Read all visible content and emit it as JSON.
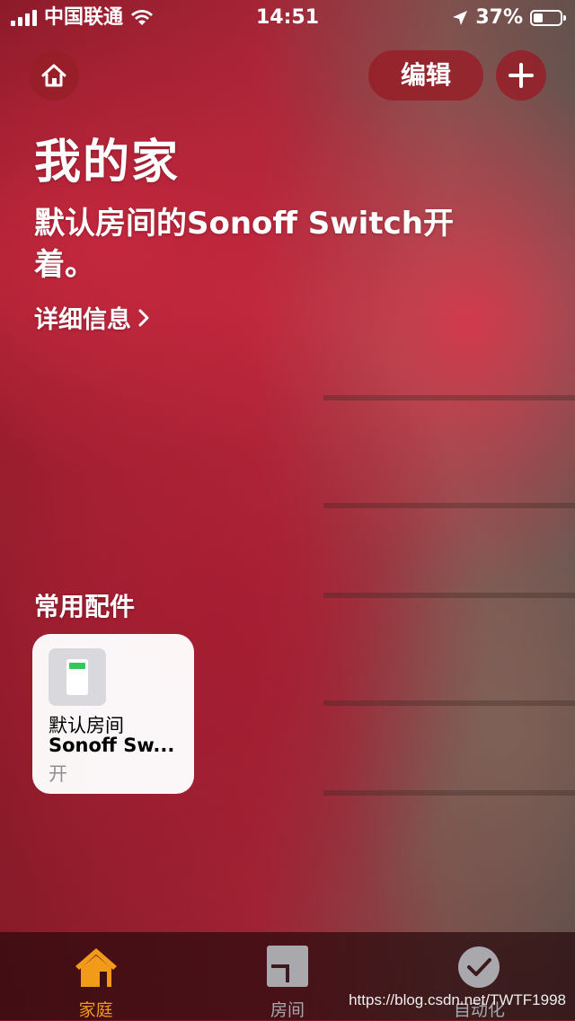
{
  "status_bar": {
    "carrier": "中国联通",
    "time": "14:51",
    "battery": "37%",
    "battery_level": 0.37
  },
  "header": {
    "edit_label": "编辑",
    "home_icon": "home-icon",
    "add_icon": "plus-icon"
  },
  "page": {
    "title": "我的家",
    "summary": "默认房间的Sonoff Switch开着。",
    "details_link": "详细信息"
  },
  "favorites": {
    "section_title": "常用配件",
    "items": [
      {
        "room": "默认房间",
        "name": "Sonoff Sw...",
        "state": "开",
        "icon": "switch-icon"
      }
    ]
  },
  "tabs": [
    {
      "label": "家庭",
      "icon": "home-icon",
      "active": true
    },
    {
      "label": "房间",
      "icon": "rooms-icon",
      "active": false
    },
    {
      "label": "自动化",
      "icon": "automation-icon",
      "active": false
    }
  ],
  "watermark": "https://blog.csdn.net/TWTF1998",
  "colors": {
    "accent": "#f29b1b",
    "button_bg": "#961e28",
    "switch_on": "#34c759"
  }
}
